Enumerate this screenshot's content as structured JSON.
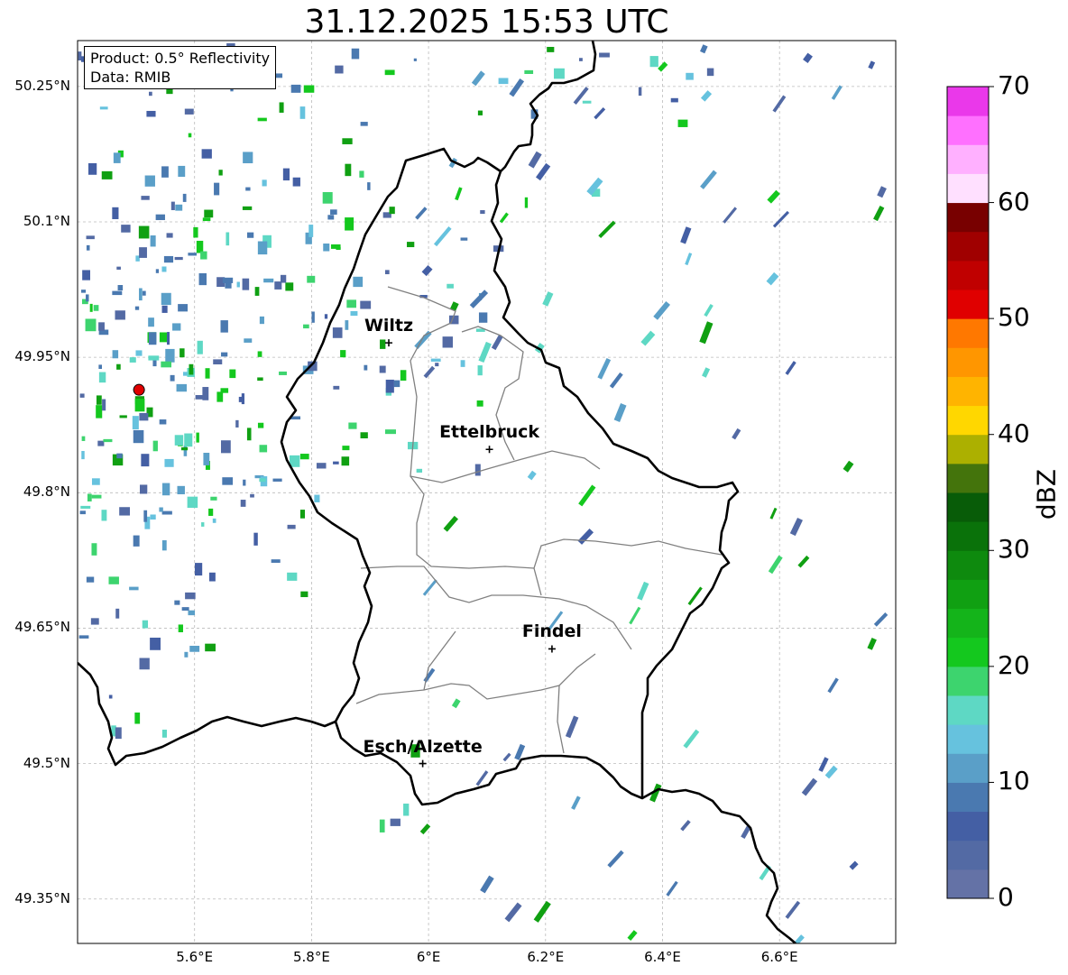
{
  "title": "31.12.2025 15:53 UTC",
  "info": {
    "product": "Product: 0.5° Reflectivity",
    "data": "Data: RMIB"
  },
  "map": {
    "lon_range": [
      5.4,
      6.8
    ],
    "lat_range": [
      49.3,
      50.3
    ],
    "lat_ticks": [
      {
        "value": 50.25,
        "label": "50.25°N"
      },
      {
        "value": 50.1,
        "label": "50.1°N"
      },
      {
        "value": 49.95,
        "label": "49.95°N"
      },
      {
        "value": 49.8,
        "label": "49.8°N"
      },
      {
        "value": 49.65,
        "label": "49.65°N"
      },
      {
        "value": 49.5,
        "label": "49.5°N"
      },
      {
        "value": 49.35,
        "label": "49.35°N"
      }
    ],
    "lon_ticks": [
      {
        "value": 5.6,
        "label": "5.6°E"
      },
      {
        "value": 5.8,
        "label": "5.8°E"
      },
      {
        "value": 6.0,
        "label": "6°E"
      },
      {
        "value": 6.2,
        "label": "6.2°E"
      },
      {
        "value": 6.4,
        "label": "6.4°E"
      },
      {
        "value": 6.6,
        "label": "6.6°E"
      }
    ],
    "grid": true,
    "radar_site": {
      "lon": 5.505,
      "lat": 49.914,
      "color": "#e00000"
    }
  },
  "cities": [
    {
      "name": "Wiltz",
      "lon": 5.932,
      "lat": 49.966
    },
    {
      "name": "Ettelbruck",
      "lon": 6.104,
      "lat": 49.848
    },
    {
      "name": "Findel",
      "lon": 6.211,
      "lat": 49.627
    },
    {
      "name": "Esch/Alzette",
      "lon": 5.99,
      "lat": 49.5
    }
  ],
  "colorbar": {
    "label": "dBZ",
    "min": 0,
    "max": 70,
    "ticks": [
      "0",
      "10",
      "20",
      "30",
      "40",
      "50",
      "60",
      "70"
    ],
    "colors": [
      "#6472a6",
      "#536aa4",
      "#445fa4",
      "#4a79b0",
      "#5a9fc8",
      "#66c2de",
      "#5ed8c4",
      "#3dd46e",
      "#14c81e",
      "#14b41a",
      "#10a012",
      "#0e8a0e",
      "#0a720a",
      "#085c08",
      "#44740c",
      "#acb000",
      "#ffd700",
      "#ffb400",
      "#ff9600",
      "#ff7800",
      "#e00000",
      "#c00000",
      "#a00000",
      "#780000",
      "#ffe0ff",
      "#ffb0ff",
      "#ff70ff",
      "#ea38ea"
    ]
  }
}
